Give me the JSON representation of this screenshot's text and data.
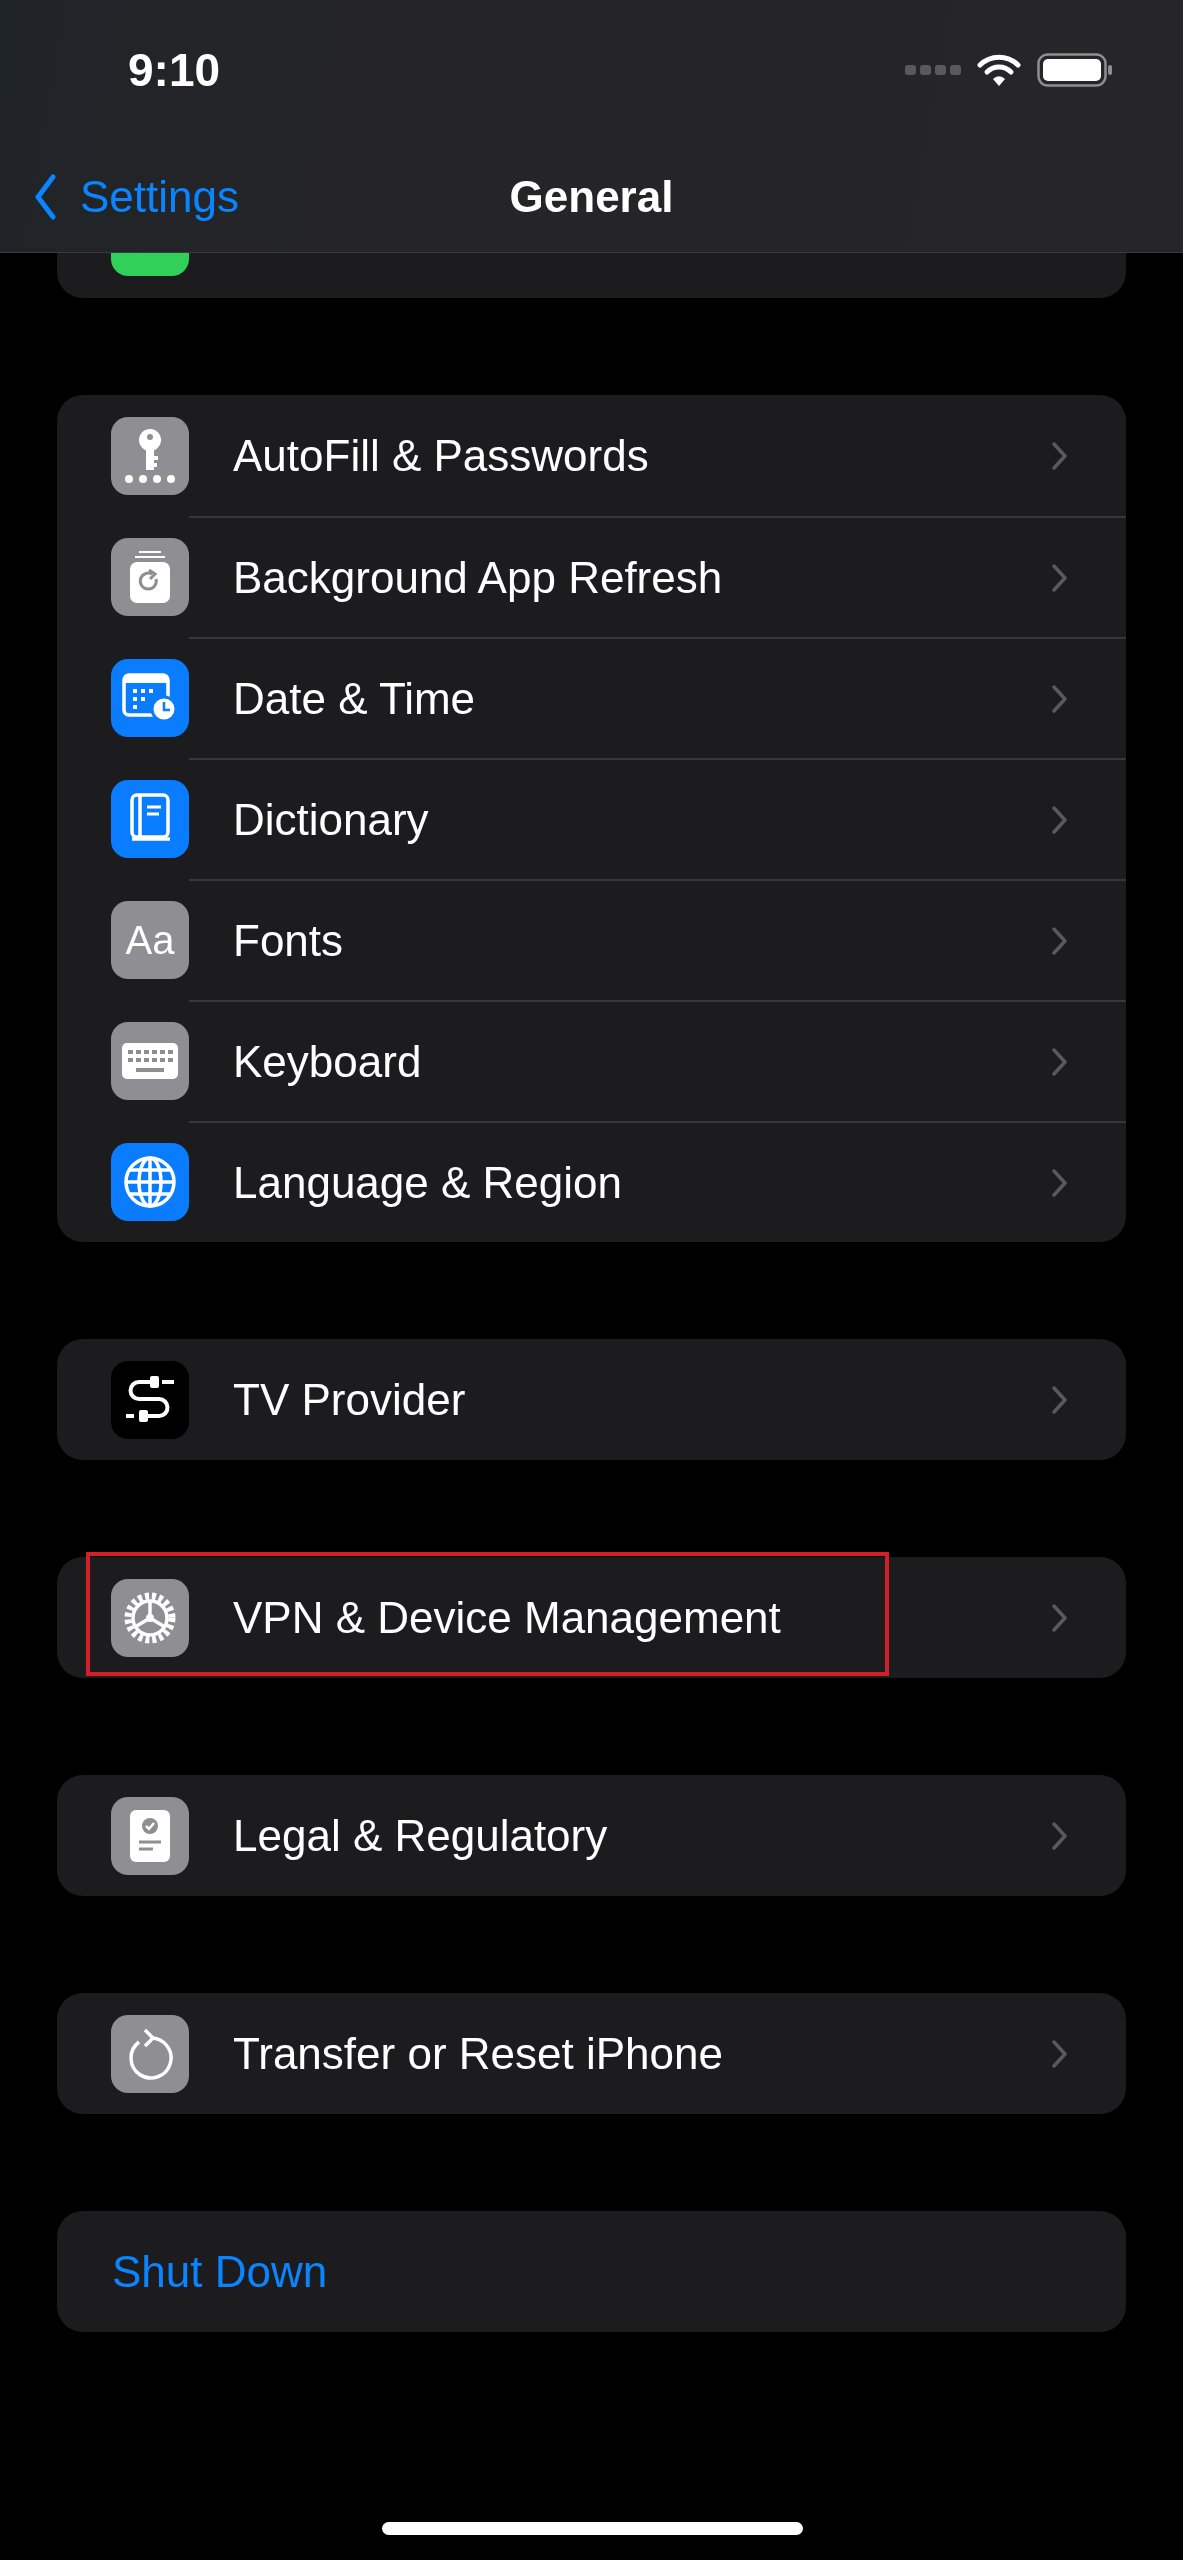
{
  "status_bar": {
    "time": "9:10"
  },
  "nav": {
    "back": "Settings",
    "title": "General"
  },
  "groups": [
    {
      "items": [
        {
          "kind": "link",
          "label": "AutoFill & Passwords",
          "highlighted": false
        },
        {
          "kind": "link",
          "label": "Background App Refresh",
          "highlighted": false
        },
        {
          "kind": "link",
          "label": "Date & Time",
          "highlighted": false
        },
        {
          "kind": "link",
          "label": "Dictionary",
          "highlighted": false
        },
        {
          "kind": "link",
          "icon_text": "Aa",
          "label": "Fonts",
          "highlighted": false
        },
        {
          "kind": "link",
          "label": "Keyboard",
          "highlighted": false
        },
        {
          "kind": "link",
          "label": "Language & Region",
          "highlighted": false
        }
      ]
    },
    {
      "items": [
        {
          "kind": "link",
          "label": "TV Provider",
          "highlighted": false
        }
      ]
    },
    {
      "items": [
        {
          "kind": "link",
          "label": "VPN & Device Management",
          "highlighted": true
        }
      ]
    },
    {
      "items": [
        {
          "kind": "link",
          "label": "Legal & Regulatory",
          "highlighted": false
        }
      ]
    },
    {
      "items": [
        {
          "kind": "link",
          "label": "Transfer or Reset iPhone",
          "highlighted": false
        }
      ]
    },
    {
      "items": [
        {
          "kind": "action",
          "label": "Shut Down",
          "highlighted": false
        }
      ]
    }
  ]
}
